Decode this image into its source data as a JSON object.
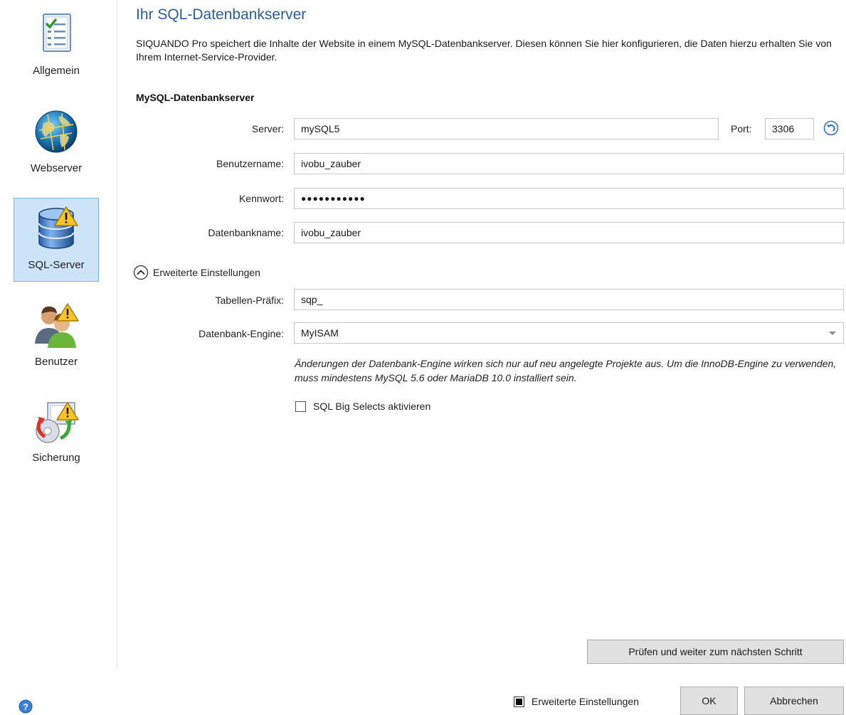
{
  "sidebar": {
    "items": [
      {
        "label": "Allgemein",
        "icon": "checklist-icon"
      },
      {
        "label": "Webserver",
        "icon": "globe-icon"
      },
      {
        "label": "SQL-Server",
        "icon": "database-warning-icon",
        "selected": true
      },
      {
        "label": "Benutzer",
        "icon": "users-warning-icon"
      },
      {
        "label": "Sicherung",
        "icon": "backup-warning-icon"
      }
    ],
    "help_icon": "help-icon"
  },
  "main": {
    "title": "Ihr SQL-Datenbankserver",
    "description": "SIQUANDO Pro speichert die Inhalte der Website in einem MySQL-Datenbankserver. Diesen können Sie hier konfigurieren, die Daten hierzu erhalten Sie von Ihrem Internet-Service-Provider.",
    "section_title": "MySQL-Datenbankserver",
    "server": {
      "label": "Server:",
      "value": "mySQL5"
    },
    "port": {
      "label": "Port:",
      "value": "3306"
    },
    "username": {
      "label": "Benutzername:",
      "value": "ivobu_zauber"
    },
    "password": {
      "label": "Kennwort:",
      "value": "●●●●●●●●●●●"
    },
    "dbname": {
      "label": "Datenbankname:",
      "value": "ivobu_zauber"
    },
    "advanced_toggle": {
      "label": "Erweiterte Einstellungen",
      "expanded": true
    },
    "prefix": {
      "label": "Tabellen-Präfix:",
      "value": "sqp_"
    },
    "engine": {
      "label": "Datenbank-Engine:",
      "value": "MyISAM"
    },
    "engine_note": "Änderungen der Datenbank-Engine wirken sich nur auf neu angelegte Projekte aus. Um die InnoDB-Engine zu verwenden, muss mindestens MySQL 5.6 oder MariaDB 10.0 installiert sein.",
    "big_selects": {
      "label": "SQL Big Selects aktivieren",
      "checked": false
    },
    "next_button": "Prüfen und weiter zum nächsten Schritt"
  },
  "footer": {
    "advanced_checkbox": {
      "label": "Erweiterte Einstellungen",
      "checked": true
    },
    "ok": "OK",
    "cancel": "Abbrechen"
  }
}
